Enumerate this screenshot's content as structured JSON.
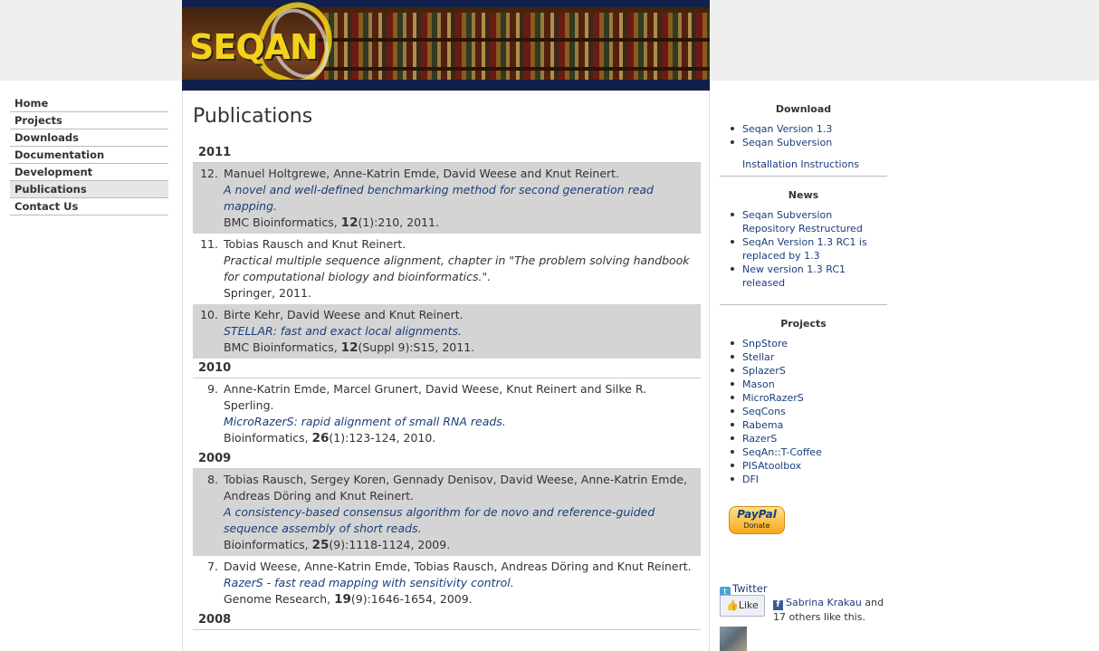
{
  "logo_text": "SEQAN",
  "nav": [
    {
      "label": "Home"
    },
    {
      "label": "Projects"
    },
    {
      "label": "Downloads"
    },
    {
      "label": "Documentation"
    },
    {
      "label": "Development"
    },
    {
      "label": "Publications",
      "active": true
    },
    {
      "label": "Contact Us"
    }
  ],
  "page_title": "Publications",
  "publications": {
    "y2011": "2011",
    "y2010": "2010",
    "y2009": "2009",
    "y2008": "2008",
    "p12": {
      "num": "12.",
      "authors": "Manuel Holtgrewe, Anne-Katrin Emde, David Weese and Knut Reinert.",
      "title": "A novel and well-defined benchmarking method for second generation read mapping.",
      "venue": "BMC Bioinformatics, ",
      "vol": "12",
      "rest": "(1):210, 2011."
    },
    "p11": {
      "num": "11.",
      "authors": "Tobias Rausch and Knut Reinert.",
      "title": "Practical multiple sequence alignment, chapter in \"The problem solving handbook for computational biology and bioinformatics.\".",
      "venue": "Springer, 2011."
    },
    "p10": {
      "num": "10.",
      "authors": "Birte Kehr, David Weese and Knut Reinert.",
      "title": "STELLAR: fast and exact local alignments.",
      "venue": "BMC Bioinformatics, ",
      "vol": "12",
      "rest": "(Suppl 9):S15, 2011."
    },
    "p9": {
      "num": "9.",
      "authors": "Anne-Katrin Emde, Marcel Grunert, David Weese, Knut Reinert and Silke R. Sperling.",
      "title": "MicroRazerS: rapid alignment of small RNA reads.",
      "venue": "Bioinformatics, ",
      "vol": "26",
      "rest": "(1):123-124, 2010."
    },
    "p8": {
      "num": "8.",
      "authors": "Tobias Rausch, Sergey Koren, Gennady Denisov, David Weese, Anne-Katrin Emde, Andreas Döring and Knut Reinert.",
      "title": "A consistency-based consensus algorithm for de novo and reference-guided sequence assembly of short reads.",
      "venue": "Bioinformatics, ",
      "vol": "25",
      "rest": "(9):1118-1124, 2009."
    },
    "p7": {
      "num": "7.",
      "authors": "David Weese, Anne-Katrin Emde, Tobias Rausch, Andreas Döring and Knut Reinert.",
      "title": "RazerS - fast read mapping with sensitivity control.",
      "venue": "Genome Research, ",
      "vol": "19",
      "rest": "(9):1646-1654, 2009."
    }
  },
  "sidebar": {
    "download_heading": "Download",
    "download_links": [
      "Seqan Version 1.3",
      "Seqan Subversion"
    ],
    "install_link": "Installation Instructions",
    "news_heading": "News",
    "news_items": [
      "Seqan Subversion Repository Restructured",
      "SeqAn Version 1.3 RC1 is replaced by 1.3",
      "New version 1.3 RC1 released"
    ],
    "projects_heading": "Projects",
    "projects": [
      "SnpStore",
      "Stellar",
      "SplazerS",
      "Mason",
      "MicroRazerS",
      "SeqCons",
      "Rabema",
      "RazerS",
      "SeqAn::T-Coffee",
      "PISAtoolbox",
      "DFI"
    ],
    "paypal_brand": "PayPal",
    "paypal_label": "Donate",
    "twitter_label": "Twitter",
    "like_label": "Like",
    "fb_name": "Sabrina Krakau",
    "fb_text": " and 17 others like this."
  },
  "colors": {
    "link": "#1a3e7a",
    "shaded_row": "#d4d4d4",
    "logo_yellow": "#f3d21a",
    "banner_navy": "#10204a"
  }
}
